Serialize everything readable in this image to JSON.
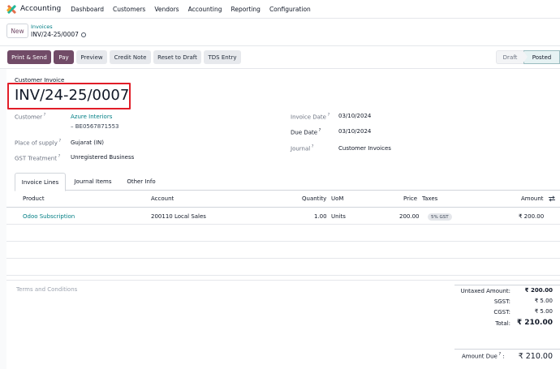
{
  "navbar": {
    "app_name": "Accounting",
    "items": [
      "Dashboard",
      "Customers",
      "Vendors",
      "Accounting",
      "Reporting",
      "Configuration"
    ]
  },
  "control_panel": {
    "new_label": "New",
    "breadcrumb_parent": "Invoices",
    "breadcrumb_current": "INV/24-25/0007"
  },
  "actions": {
    "print_send": "Print & Send",
    "pay": "Pay",
    "preview": "Preview",
    "credit_note": "Credit Note",
    "reset_to_draft": "Reset to Draft",
    "tds_entry": "TDS Entry"
  },
  "status": {
    "draft": "Draft",
    "posted": "Posted",
    "current": "Posted"
  },
  "form": {
    "subtitle": "Customer Invoice",
    "invoice_number": "INV/24-25/0007",
    "customer_label": "Customer",
    "customer_name": "Azure Interiors",
    "customer_vat": "– BE0567871553",
    "place_of_supply_label": "Place of supply",
    "place_of_supply": "Gujarat (IN)",
    "gst_treatment_label": "GST Treatment",
    "gst_treatment": "Unregistered Business",
    "invoice_date_label": "Invoice Date",
    "invoice_date": "03/10/2024",
    "due_date_label": "Due Date",
    "due_date": "03/10/2024",
    "journal_label": "Journal",
    "journal": "Customer Invoices"
  },
  "tabs": [
    "Invoice Lines",
    "Journal Items",
    "Other Info"
  ],
  "table": {
    "headers": {
      "product": "Product",
      "account": "Account",
      "quantity": "Quantity",
      "uom": "UoM",
      "price": "Price",
      "taxes": "Taxes",
      "amount": "Amount"
    },
    "rows": [
      {
        "product": "Odoo Subscription",
        "account": "200110 Local Sales",
        "quantity": "1.00",
        "uom": "Units",
        "price": "200.00",
        "tax": "5% GST",
        "amount": "₹ 200.00"
      }
    ]
  },
  "terms_placeholder": "Terms and Conditions",
  "totals": {
    "untaxed_label": "Untaxed Amount:",
    "untaxed": "₹ 200.00",
    "sgst_label": "SGST:",
    "sgst": "₹ 5.00",
    "cgst_label": "CGST:",
    "cgst": "₹ 5.00",
    "total_label": "Total:",
    "total": "₹ 210.00",
    "amount_due_label": "Amount Due",
    "amount_due": "₹ 210.00"
  },
  "colors": {
    "brand": "#714b67",
    "link": "#017e84",
    "highlight": "#e11d28"
  }
}
